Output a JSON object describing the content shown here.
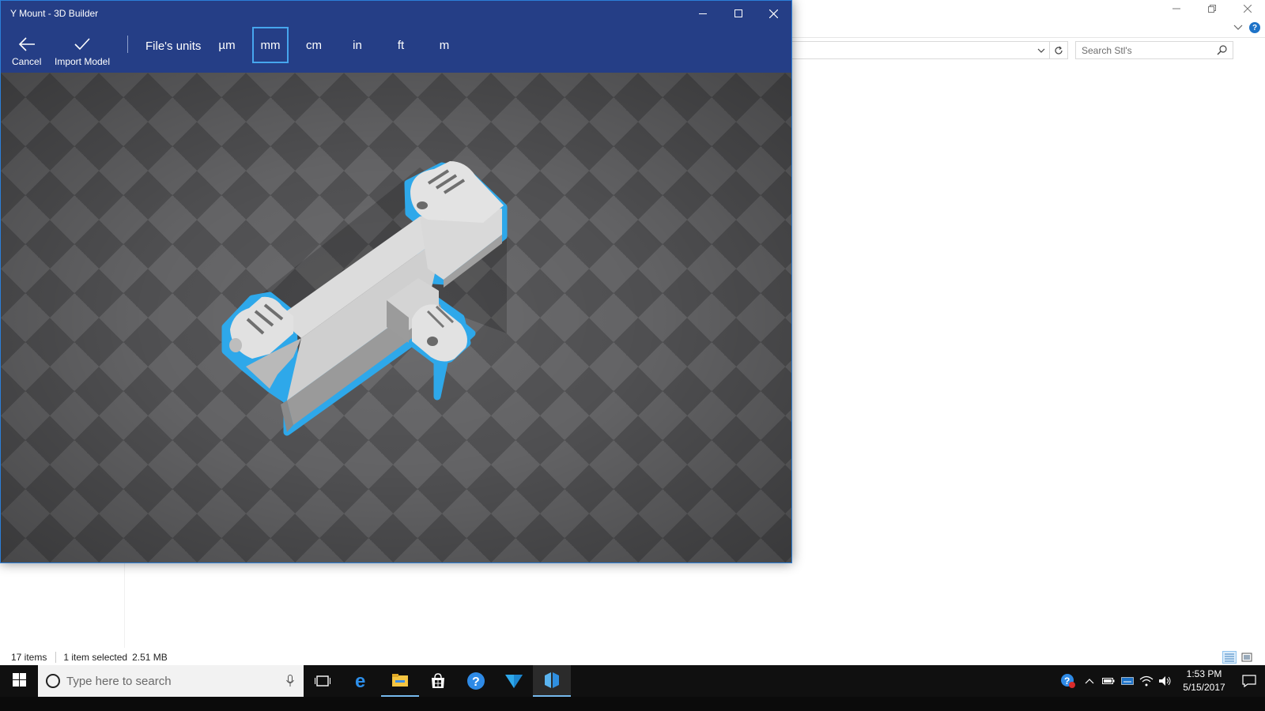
{
  "explorer": {
    "search_placeholder": "Search Stl's",
    "status": {
      "item_count": "17 items",
      "selected": "1 item selected",
      "size": "2.51 MB"
    }
  },
  "builder": {
    "window_title": "Y Mount - 3D Builder",
    "toolbar": {
      "cancel_label": "Cancel",
      "import_label": "Import Model",
      "units_label": "File's units",
      "units": [
        {
          "label": "µm",
          "selected": false
        },
        {
          "label": "mm",
          "selected": true
        },
        {
          "label": "cm",
          "selected": false
        },
        {
          "label": "in",
          "selected": false
        },
        {
          "label": "ft",
          "selected": false
        },
        {
          "label": "m",
          "selected": false
        }
      ]
    },
    "colors": {
      "title_bar": "#253e86",
      "selection_outline": "#2ea8ea",
      "model": "#d8d8d8"
    }
  },
  "taskbar": {
    "search_placeholder": "Type here to search",
    "apps": [
      "task-view-icon",
      "edge-icon",
      "file-explorer-icon",
      "store-icon",
      "help-icon",
      "feedback-icon",
      "3d-builder-icon"
    ],
    "clock": {
      "time": "1:53 PM",
      "date": "5/15/2017"
    }
  }
}
